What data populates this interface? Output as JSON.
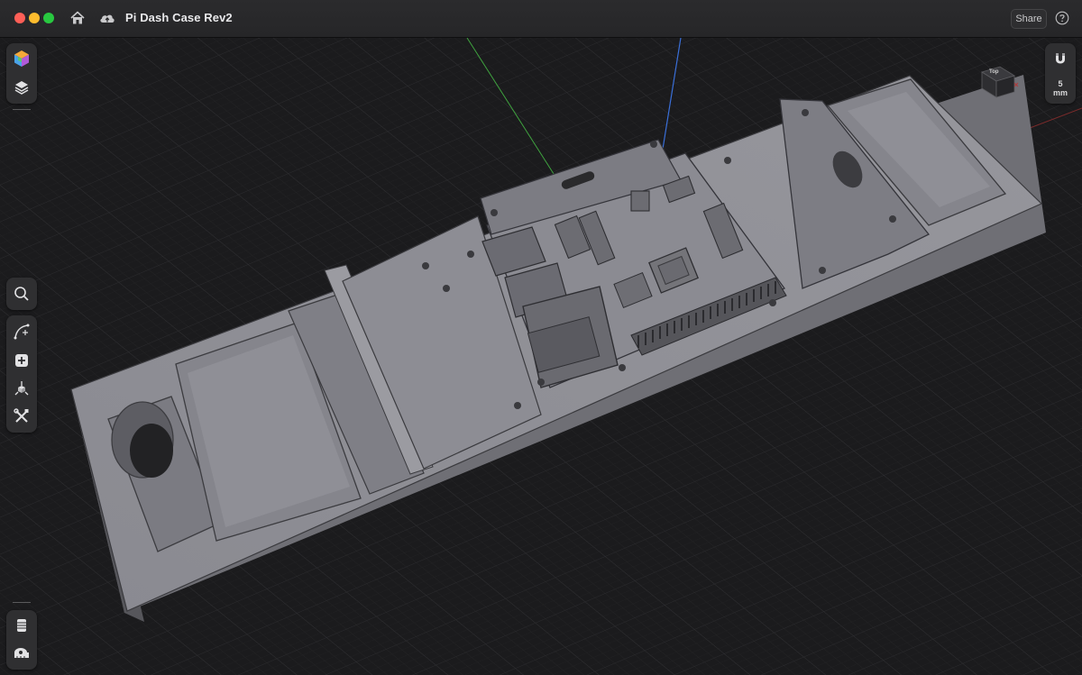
{
  "window": {
    "title": "Pi Dash Case Rev2",
    "share_label": "Share"
  },
  "toolbar": {
    "left_top": [
      {
        "icon": "appearance-cube-icon"
      },
      {
        "icon": "layers-icon"
      }
    ],
    "left_middle": [
      {
        "icon": "search-icon"
      },
      {
        "icon": "sketch-curve-icon"
      },
      {
        "icon": "add-primitive-icon"
      },
      {
        "icon": "transform-icon"
      },
      {
        "icon": "tools-icon"
      }
    ],
    "left_bottom": [
      {
        "icon": "slicer-icon"
      },
      {
        "icon": "measure-icon"
      }
    ],
    "right": {
      "snap_icon": "magnet-icon",
      "snap_value": "5",
      "snap_unit": "mm"
    }
  },
  "viewcube": {
    "face_label": "Top"
  },
  "colors": {
    "background": "#1a1a1c",
    "grid": "#2c2c2e",
    "model": "#8c8c93",
    "axis_y": "#3fa33f",
    "axis_z": "#3a6fd8",
    "axis_x": "#b23a3a"
  }
}
